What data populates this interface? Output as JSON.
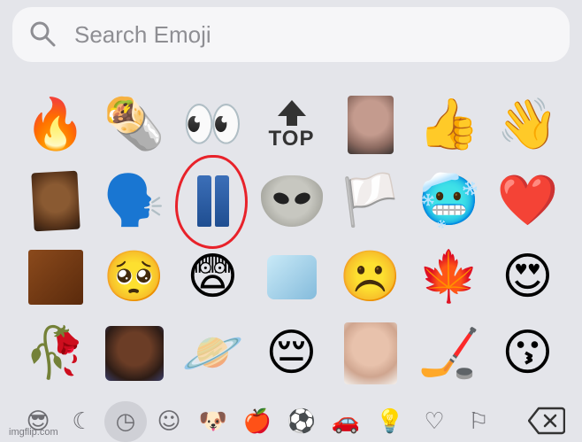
{
  "search": {
    "placeholder": "Search Emoji"
  },
  "emoji_grid": [
    [
      "🔥",
      "🌯",
      "👀",
      "TOP",
      "old-man-photo",
      "👍",
      "👋"
    ],
    [
      "meme-face-photo",
      "🗣️",
      "👖",
      "alien-face-photo",
      "🏳️",
      "🥶",
      "❤️"
    ],
    [
      "🟫",
      "🥺",
      "😨",
      "🧊",
      "☹️",
      "🍁",
      "😍"
    ],
    [
      "🥀",
      "man-headset-photo",
      "🪐",
      "😔",
      "boy-face-photo",
      "🏒",
      "😗"
    ]
  ],
  "top_emoji_text": "TOP",
  "toolbar": {
    "categories": [
      "smileys-recent",
      "stickers",
      "recent",
      "smileys",
      "animals",
      "food",
      "activity",
      "travel",
      "objects",
      "symbols",
      "flags"
    ],
    "icons": [
      "😎",
      "☾",
      "◷",
      "☺",
      "🐶",
      "🍎",
      "⚽",
      "🚗",
      "💡",
      "♡",
      "⚐"
    ]
  },
  "watermark": "imgflip.com",
  "colors": {
    "background": "#e4e5ea",
    "search_bg": "#f6f6f8",
    "highlight": "#e8222a"
  }
}
